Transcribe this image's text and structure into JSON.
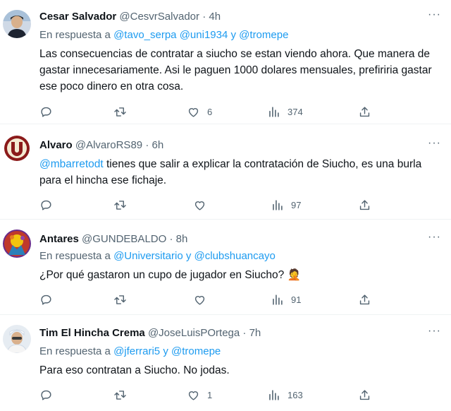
{
  "tweets": [
    {
      "name": "Cesar Salvador",
      "handle": "@CesvrSalvador",
      "time": "4h",
      "reply_prefix": "En respuesta a",
      "reply_mentions": [
        "@tavo_serpa",
        "@uni1934"
      ],
      "reply_last": "@tromepe",
      "text": "Las consecuencias de contratar a siucho se estan viendo ahora. Que manera de gastar innecesariamente. Asi le paguen 1000 dolares mensuales, prefiriria gastar ese poco dinero en otra cosa.",
      "likes": "6",
      "views": "374"
    },
    {
      "name": "Alvaro",
      "handle": "@AlvaroRS89",
      "time": "6h",
      "text_mention": "@mbarretodt",
      "text": "tienes que salir a explicar la contratación de Siucho, es una burla para el hincha ese fichaje.",
      "views": "97"
    },
    {
      "name": "Antares",
      "handle": "@GUNDEBALDO",
      "time": "8h",
      "reply_prefix": "En respuesta a",
      "reply_first": "@Universitario",
      "reply_last": "@clubshuancayo",
      "text": "¿Por qué gastaron un cupo de jugador en Siucho?",
      "emoji": "🤦",
      "views": "91"
    },
    {
      "name": "Tim El Hincha Crema",
      "handle": "@JoseLuisPOrtega",
      "time": "7h",
      "reply_prefix": "En respuesta a",
      "reply_first": "@jferrari5",
      "reply_last": "@tromepe",
      "text": "Para eso contratan a Siucho. No jodas.",
      "likes": "1",
      "views": "163"
    }
  ],
  "separators": {
    "dot": "·",
    "y": "y",
    "comma_space": " "
  },
  "icons": {
    "reply": "reply-icon",
    "retweet": "retweet-icon",
    "like": "like-icon",
    "views": "views-icon",
    "share": "share-icon",
    "more": "more-icon"
  },
  "colors": {
    "link": "#1d9bf0",
    "muted": "#536471",
    "text": "#0f1419",
    "border": "#eff3f4"
  }
}
